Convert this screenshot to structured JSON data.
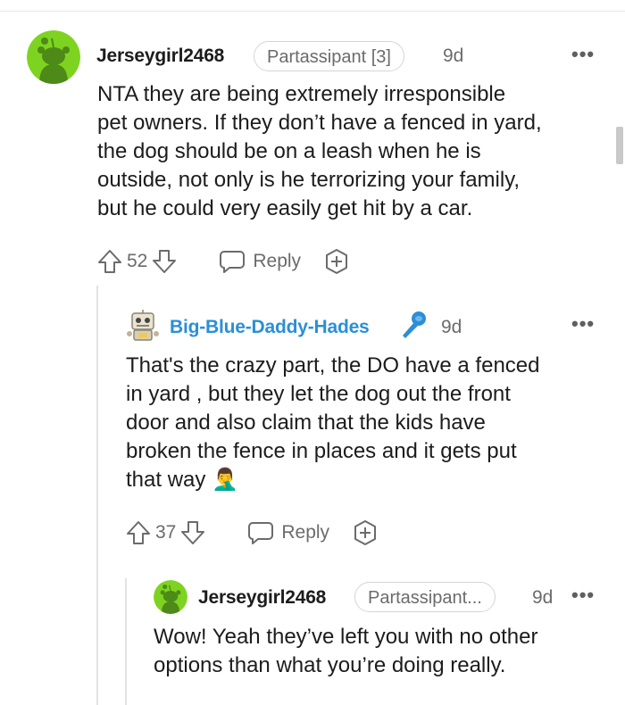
{
  "comment1": {
    "username": "Jerseygirl2468",
    "flair": "Partassipant [3]",
    "time": "9d",
    "more": "•••",
    "lines": [
      "NTA they are being extremely irresponsible",
      "pet owners. If they don’t have a fenced in yard,",
      "the dog should be on a leash when he is",
      "outside, not only is he terrorizing your family,",
      "but he could very easily get hit by a car."
    ],
    "votes": "52",
    "reply_label": "Reply"
  },
  "comment2": {
    "username": "Big-Blue-Daddy-Hades",
    "time": "9d",
    "more": "•••",
    "lines": [
      "That's the crazy part, the DO have a fenced",
      "in yard , but they let the dog out the front",
      "door and also claim that the kids have",
      "broken the fence in places and it gets put",
      "that way"
    ],
    "emoji": "🤦‍♂️",
    "votes": "37",
    "reply_label": "Reply"
  },
  "comment3": {
    "username": "Jerseygirl2468",
    "flair": "Partassipant...",
    "time": "9d",
    "more": "•••",
    "lines": [
      "Wow! Yeah they’ve left you with no other",
      "options than what you’re doing really."
    ]
  },
  "colors": {
    "avatar_green": "#7ED321",
    "op_blue": "#2b8fd6",
    "text": "#1c1c1c",
    "meta": "#6b6b6b"
  }
}
